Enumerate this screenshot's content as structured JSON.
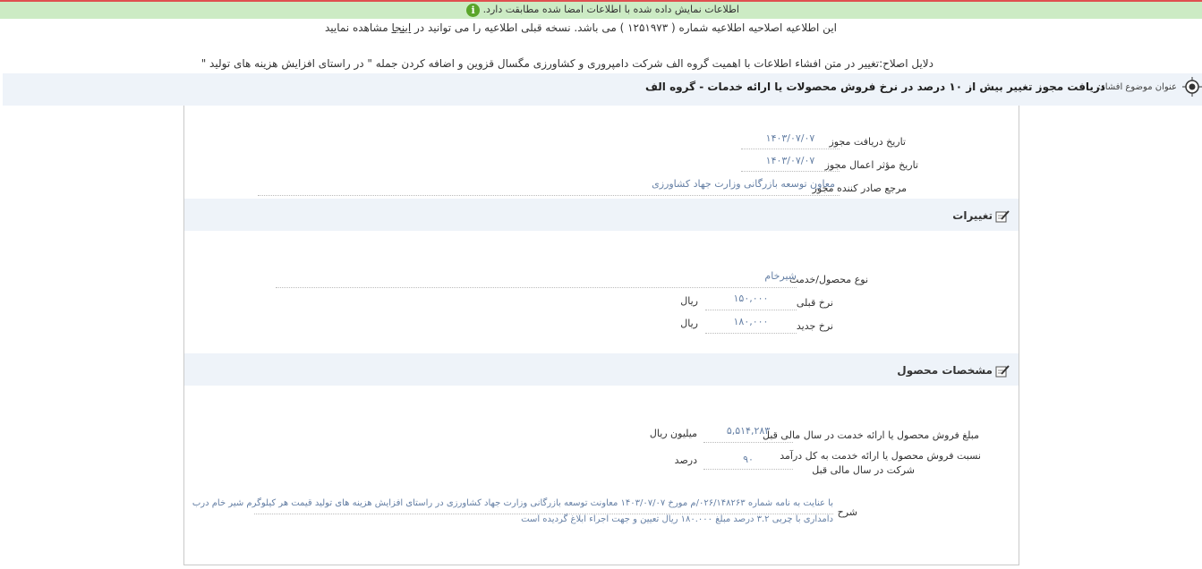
{
  "banner": {
    "text": "اطلاعات نمایش داده شده با اطلاعات امضا شده مطابقت دارد.",
    "icon": "info-icon"
  },
  "notice": {
    "text_before": "این اطلاعیه اصلاحیه اطلاعیه شماره ( ۱۲۵۱۹۷۳ ) می باشد. نسخه قبلی اطلاعیه را می توانید در ",
    "link": "اینجا",
    "text_after": " مشاهده نمایید",
    "reason": "دلایل اصلاح:تغییر در متن افشاء اطلاعات با اهمیت گروه الف شرکت دامپروری و کشاورزی مگسال قزوین و اضافه کردن جمله \" در راستای افزایش هزینه های تولید \""
  },
  "subject": {
    "label": "عنوان موضوع افشاء:",
    "value": "دریافت مجوز تغییر بیش از ۱۰ درصد در نرخ فروش محصولات یا ارائه خدمات - گروه الف"
  },
  "license": {
    "receive_date_label": "تاریخ دریافت مجوز",
    "receive_date": "۱۴۰۳/۰۷/۰۷",
    "effective_date_label": "تاریخ مؤثر اعمال مجوز",
    "effective_date": "۱۴۰۳/۰۷/۰۷",
    "issuer_label": "مرجع صادر کننده مجوز",
    "issuer": "معاون توسعه بازرگانی وزارت جهاد کشاورزی"
  },
  "changes": {
    "title": "تغییرات",
    "product_label": "نوع محصول/خدمت",
    "product": "شیرخام",
    "prev_rate_label": "نرخ قبلی",
    "prev_rate": "۱۵۰,۰۰۰",
    "new_rate_label": "نرخ جدید",
    "new_rate": "۱۸۰,۰۰۰",
    "unit": "ریال"
  },
  "product_spec": {
    "title": "مشخصات محصول",
    "sales_label": "مبلغ فروش محصول یا ارائه خدمت در سال مالی قبل",
    "sales": "۵,۵۱۴,۲۸۳",
    "sales_unit": "میلیون ریال",
    "ratio_label_1": "نسبت فروش محصول یا ارائه خدمت به کل درآمد",
    "ratio_label_2": "شرکت در سال مالی قبل",
    "ratio": "۹۰",
    "ratio_unit": "درصد",
    "desc_label": "شرح",
    "desc_line1": "با عنایت به نامه شماره ۰۲۶/۱۴۸۲۶۳/م مورخ ۱۴۰۳/۰۷/۰۷ معاونت توسعه بازرگانی وزارت جهاد کشاورزی در راستای افزایش هزینه های تولید قیمت هر کیلوگرم شیر خام درب",
    "desc_line2": "دامداری با چربی ۳.۲ درصد مبلغ ۱۸۰.۰۰۰ ریال تعیین و جهت اجراء ابلاغ گردیده است"
  },
  "colors": {
    "banner_bg": "#ccebc4",
    "section_bg": "#eef3f9",
    "value_text": "#6680a5"
  }
}
